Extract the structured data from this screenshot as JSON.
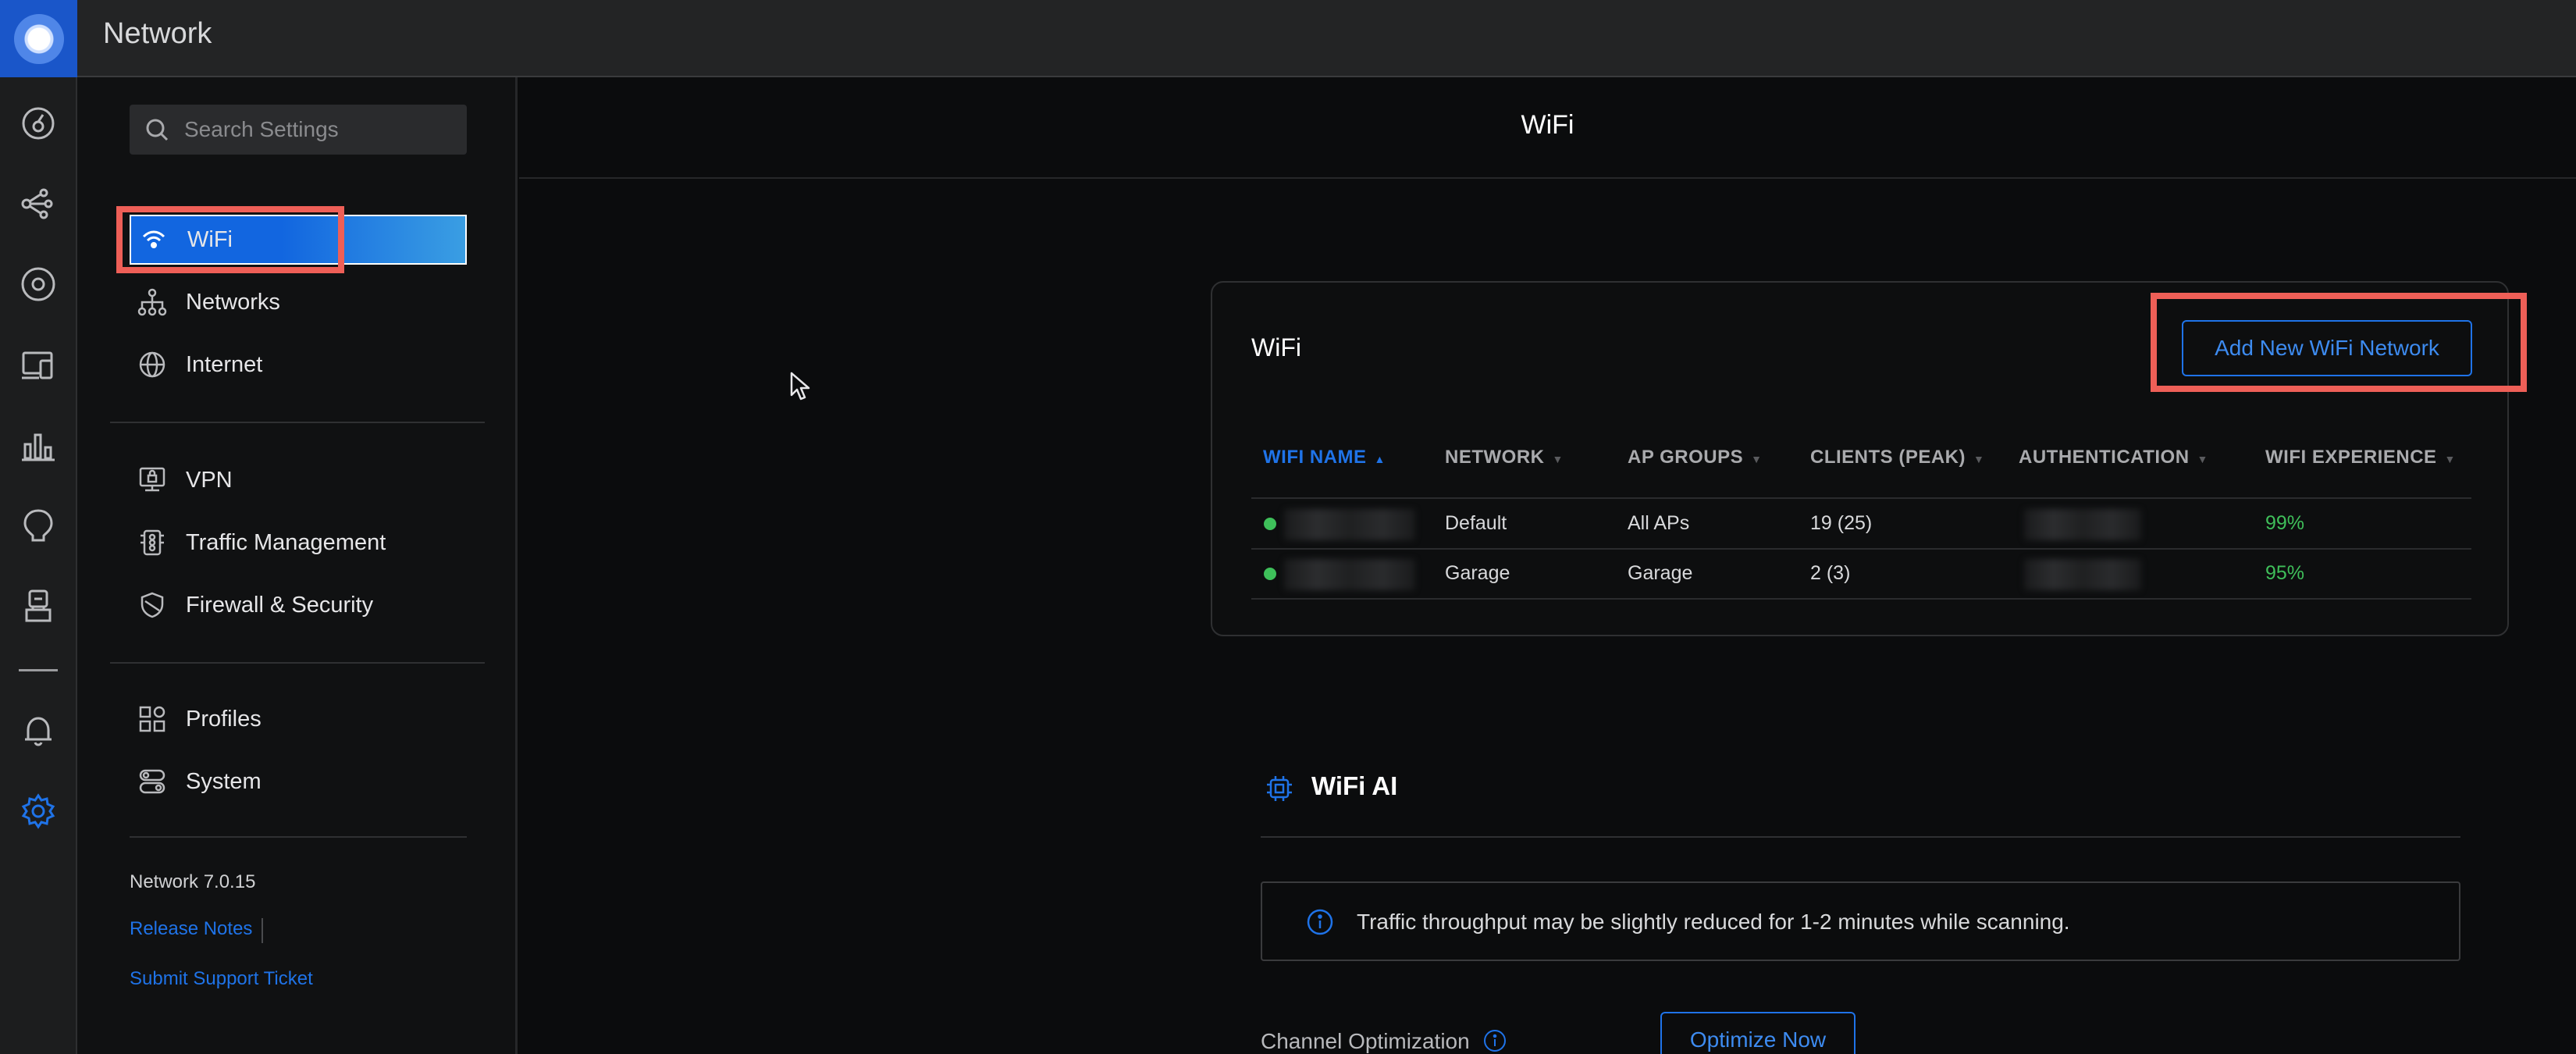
{
  "app": {
    "title": "Network"
  },
  "rail": {
    "icons": [
      "dashboard-icon",
      "topology-icon",
      "devices-icon",
      "client-devices-icon",
      "statistics-icon",
      "insights-icon",
      "system-log-icon",
      "notifications-icon",
      "settings-icon"
    ],
    "active_color": "#1f73e8"
  },
  "sidebar": {
    "search_placeholder": "Search Settings",
    "groups": [
      [
        {
          "label": "WiFi",
          "icon": "wifi-icon",
          "active": true
        },
        {
          "label": "Networks",
          "icon": "networks-icon"
        },
        {
          "label": "Internet",
          "icon": "globe-icon"
        }
      ],
      [
        {
          "label": "VPN",
          "icon": "vpn-icon"
        },
        {
          "label": "Traffic Management",
          "icon": "traffic-management-icon"
        },
        {
          "label": "Firewall & Security",
          "icon": "firewall-icon"
        }
      ],
      [
        {
          "label": "Profiles",
          "icon": "profiles-icon"
        },
        {
          "label": "System",
          "icon": "system-icon"
        }
      ]
    ],
    "version": "Network 7.0.15",
    "release_notes": "Release Notes",
    "support": "Submit Support Ticket"
  },
  "main": {
    "title": "WiFi",
    "wifi_card": {
      "title": "WiFi",
      "add_button": "Add New WiFi Network",
      "columns": [
        "WIFI NAME",
        "NETWORK",
        "AP GROUPS",
        "CLIENTS (PEAK)",
        "AUTHENTICATION",
        "WIFI EXPERIENCE"
      ],
      "sorted_column": "WIFI NAME",
      "rows": [
        {
          "name": "",
          "network": "Default",
          "ap_groups": "All APs",
          "clients": "19 (25)",
          "authentication": "",
          "experience": "99%",
          "status_color": "#3ec05a"
        },
        {
          "name": "",
          "network": "Garage",
          "ap_groups": "Garage",
          "clients": "2 (3)",
          "authentication": "",
          "experience": "95%",
          "status_color": "#3ec05a"
        }
      ]
    },
    "wifi_ai": {
      "title": "WiFi AI",
      "notice": "Traffic throughput may be slightly reduced for 1-2 minutes while scanning.",
      "channel_optimization_label": "Channel Optimization",
      "optimize_button": "Optimize Now"
    }
  },
  "highlight_color": "#ee5f57"
}
